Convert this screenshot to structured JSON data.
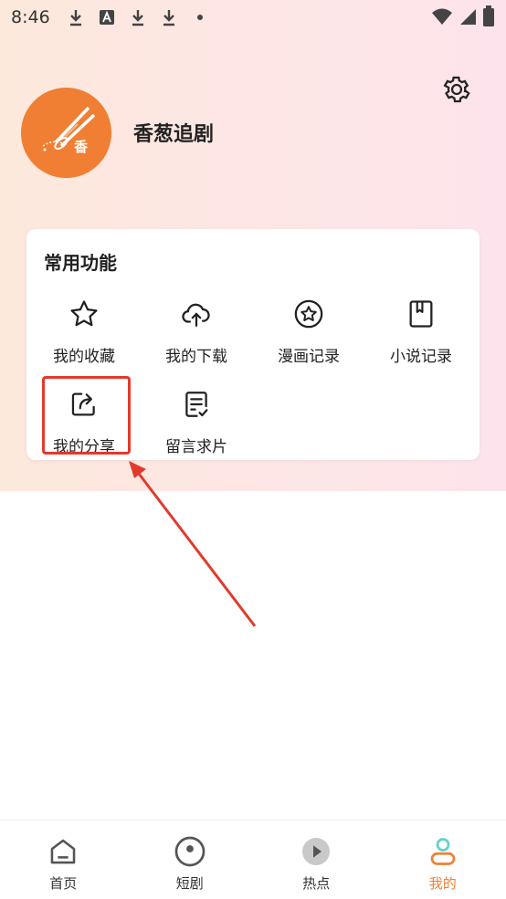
{
  "status_bar": {
    "time": "8:46",
    "left_icons": [
      "download-icon",
      "a-icon",
      "download-icon",
      "download-icon",
      "dot-icon"
    ],
    "right_icons": [
      "wifi-icon",
      "signal-icon",
      "battery-icon"
    ]
  },
  "profile": {
    "app_name": "香葱追剧",
    "avatar_text": "香"
  },
  "functions": {
    "title": "常用功能",
    "items": [
      {
        "label": "我的收藏",
        "icon": "star-icon"
      },
      {
        "label": "我的下载",
        "icon": "cloud-upload-icon"
      },
      {
        "label": "漫画记录",
        "icon": "star-circle-icon"
      },
      {
        "label": "小说记录",
        "icon": "book-icon"
      },
      {
        "label": "我的分享",
        "icon": "share-icon"
      },
      {
        "label": "留言求片",
        "icon": "note-check-icon"
      }
    ]
  },
  "bottom_nav": [
    {
      "label": "首页",
      "icon": "home-icon"
    },
    {
      "label": "短剧",
      "icon": "disc-icon"
    },
    {
      "label": "热点",
      "icon": "play-circle-icon"
    },
    {
      "label": "我的",
      "icon": "user-icon",
      "active": true
    }
  ],
  "colors": {
    "accent": "#f07f33",
    "highlight": "#e13a2b"
  }
}
